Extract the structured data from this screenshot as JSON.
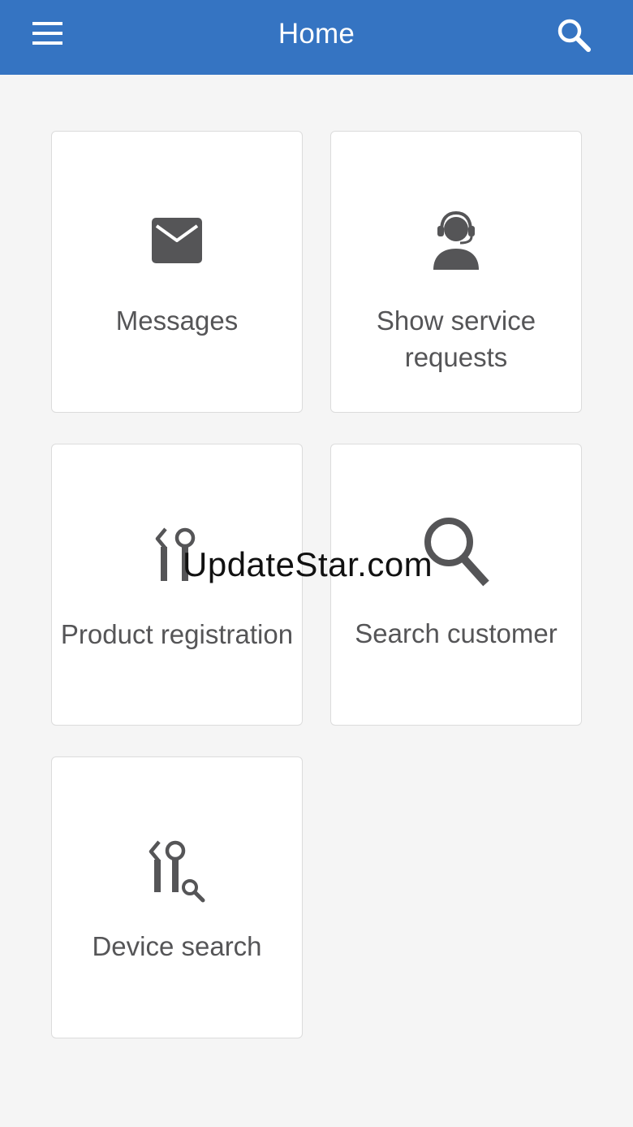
{
  "appbar": {
    "title": "Home",
    "menu_icon": "hamburger-menu-icon",
    "search_icon": "search-icon",
    "background": "#3574c2"
  },
  "tiles": [
    {
      "label": "Messages",
      "icon": "envelope-icon"
    },
    {
      "label": "Show service requests",
      "icon": "headset-agent-icon"
    },
    {
      "label": "Product registration",
      "icon": "tools-icon"
    },
    {
      "label": "Search customer",
      "icon": "magnifier-icon"
    },
    {
      "label": "Device search",
      "icon": "tools-search-icon"
    }
  ],
  "watermark": "UpdateStar.com",
  "colors": {
    "icon": "#555557",
    "tile_border": "#dcdcdc",
    "page_background": "#f5f5f5"
  }
}
